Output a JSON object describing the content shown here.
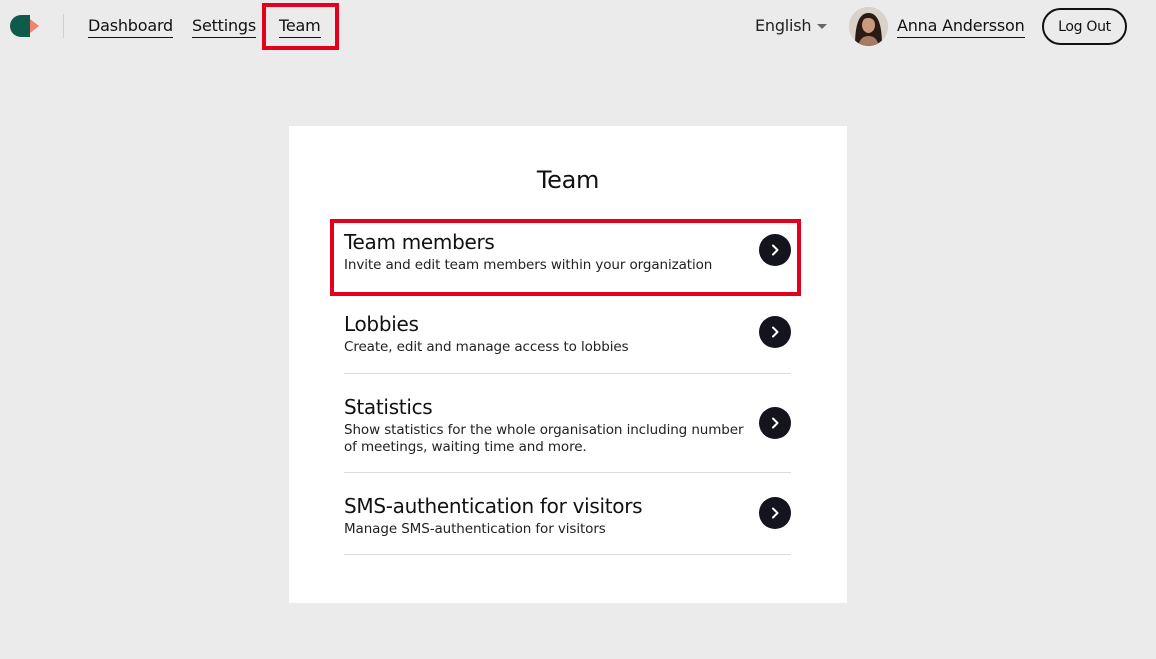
{
  "header": {
    "nav": [
      {
        "label": "Dashboard"
      },
      {
        "label": "Settings"
      },
      {
        "label": "Team"
      }
    ],
    "language": "English",
    "user_name": "Anna Andersson",
    "logout_label": "Log Out"
  },
  "main": {
    "title": "Team",
    "items": [
      {
        "title": "Team members",
        "description": "Invite and edit team members within your organization",
        "icon": "chevron-right-icon"
      },
      {
        "title": "Lobbies",
        "description": "Create, edit and manage access to lobbies",
        "icon": "chevron-right-icon"
      },
      {
        "title": "Statistics",
        "description": "Show statistics for the whole organisation including number of meetings, waiting time and more.",
        "icon": "chevron-right-icon"
      },
      {
        "title": "SMS-authentication for visitors",
        "description": "Manage SMS-authentication for visitors",
        "icon": "chevron-right-icon"
      }
    ]
  },
  "colors": {
    "background": "#ebebeb",
    "card": "#ffffff",
    "logo_teal": "#0e5a4b",
    "logo_coral": "#f0836e",
    "highlight": "#e3001b",
    "arrow_button": "#14141f"
  }
}
